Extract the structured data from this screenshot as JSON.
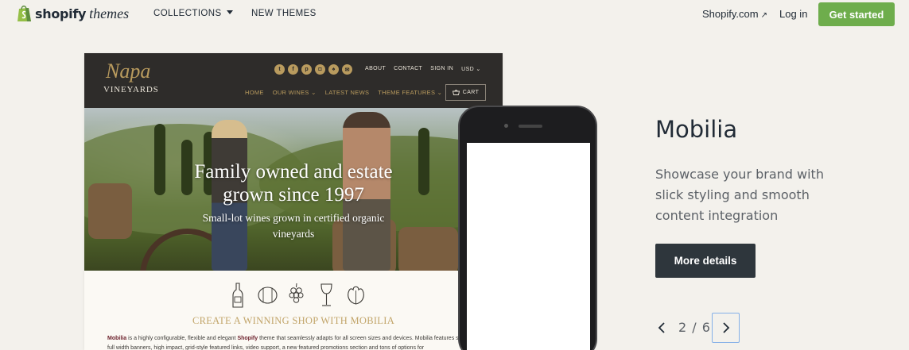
{
  "topnav": {
    "logo_word": "shopify",
    "logo_sub": "themes",
    "collections_label": "COLLECTIONS",
    "new_themes_label": "NEW THEMES",
    "shopify_com_label": "Shopify.com",
    "shopify_com_arrow": "↗",
    "login_label": "Log in",
    "get_started_label": "Get started",
    "accent_color": "#6ead4c"
  },
  "preview": {
    "logo_script": "Napa",
    "logo_caption": "VINEYARDS",
    "social_icons": [
      "twitter-icon",
      "facebook-icon",
      "pinterest-icon",
      "instagram-icon",
      "snapchat-icon",
      "email-icon"
    ],
    "top_links": [
      "ABOUT",
      "CONTACT",
      "SIGN IN",
      "USD ⌄"
    ],
    "main_nav": [
      "HOME",
      "OUR WINES ⌄",
      "LATEST NEWS",
      "THEME FEATURES ⌄"
    ],
    "cart_label": "CART",
    "hero_title_line1": "Family owned and estate",
    "hero_title_line2": "grown since 1997",
    "hero_sub_line1": "Small-lot wines grown in certified organic",
    "hero_sub_line2": "vineyards",
    "feature_icons": [
      "wine-bottle-icon",
      "barrel-icon",
      "grapes-icon",
      "wine-glass-icon",
      "grape-leaf-icon"
    ],
    "section_heading": "CREATE A WINNING SHOP WITH MOBILIA",
    "body_brand": "Mobilia",
    "body_text_a": " is a highly configurable, flexible and elegant ",
    "body_link": "Shopify",
    "body_text_b": " theme that seamlessly adapts for all screen sizes and devices. Mobilia features stunning full width banners, high impact, grid-style featured links, video support, a new featured promotions section and tons of options for"
  },
  "theme": {
    "name": "Mobilia",
    "description": "Showcase your brand with slick styling and smooth content integration",
    "details_label": "More details"
  },
  "pager": {
    "count": "2 / 6"
  }
}
